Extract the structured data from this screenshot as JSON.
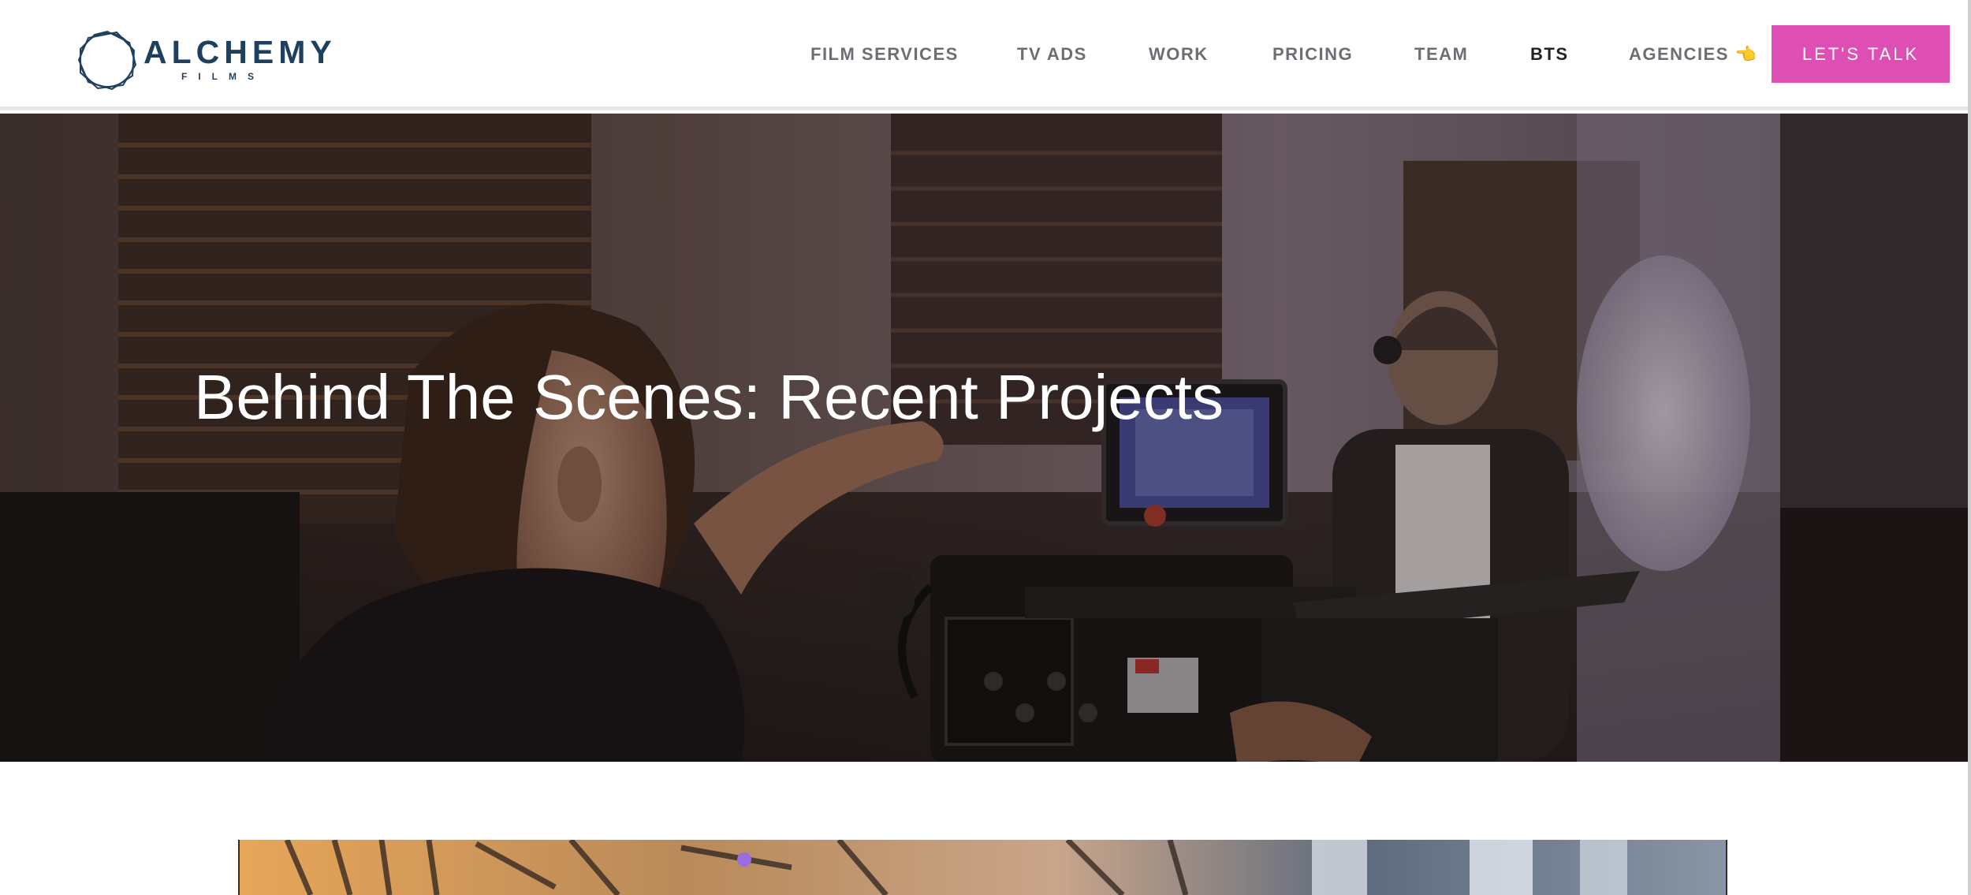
{
  "brand": {
    "name": "ALCHEMY",
    "tagline": "FILMS",
    "color": "#1e3f5e"
  },
  "nav": {
    "items": [
      {
        "label": "FILM SERVICES",
        "active": false
      },
      {
        "label": "TV ADS",
        "active": false
      },
      {
        "label": "WORK",
        "active": false
      },
      {
        "label": "PRICING",
        "active": false
      },
      {
        "label": "TEAM",
        "active": false
      },
      {
        "label": "BTS",
        "active": true
      },
      {
        "label": "AGENCIES 👈",
        "active": false
      }
    ],
    "cta_label": "LET'S TALK",
    "cta_color": "#de4fb4"
  },
  "hero": {
    "title": "Behind The Scenes: Recent Projects",
    "image_icon": "film-set-photo"
  }
}
